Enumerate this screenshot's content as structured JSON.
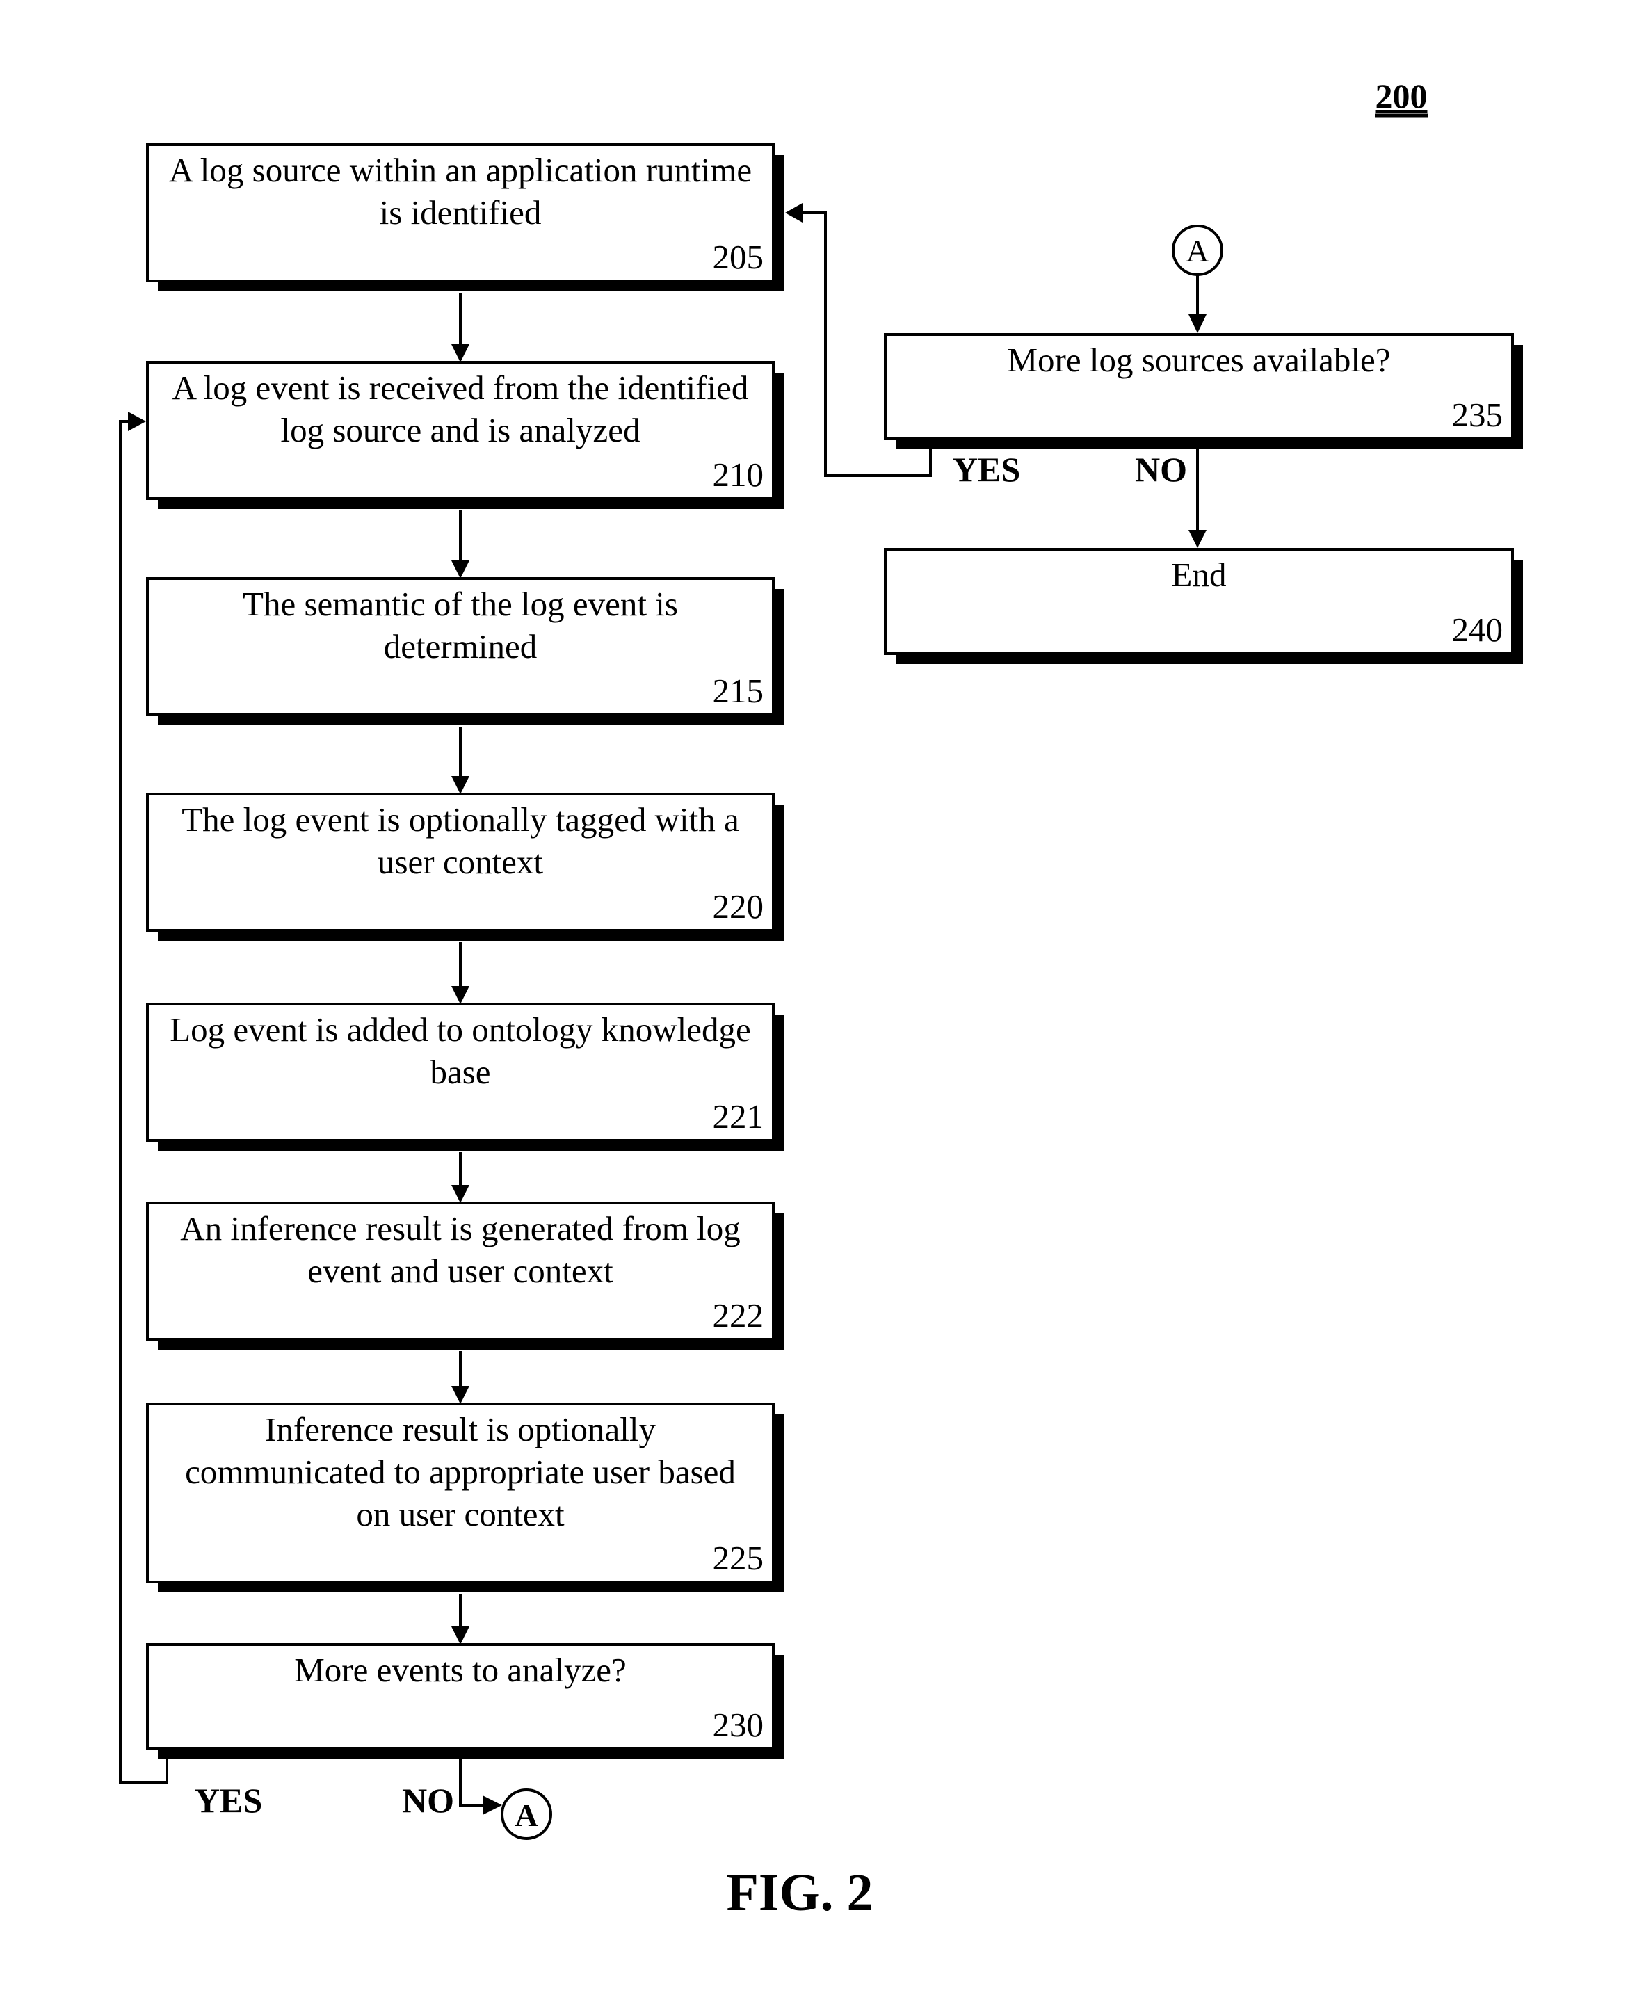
{
  "figure": {
    "reference_number": "200",
    "caption": "FIG. 2"
  },
  "steps": [
    {
      "id": "205",
      "lines": [
        "A log source within an application runtime",
        "is identified"
      ]
    },
    {
      "id": "210",
      "lines": [
        "A log event is received from the identified",
        "log source and is analyzed"
      ]
    },
    {
      "id": "215",
      "lines": [
        "The semantic of the log event is",
        "determined"
      ]
    },
    {
      "id": "220",
      "lines": [
        "The log event is optionally tagged with a",
        "user context"
      ]
    },
    {
      "id": "221",
      "lines": [
        "Log event is added to ontology knowledge",
        "base"
      ]
    },
    {
      "id": "222",
      "lines": [
        "An inference result is generated from log",
        "event and user context"
      ]
    },
    {
      "id": "225",
      "lines": [
        "Inference result is optionally",
        "communicated to appropriate user based",
        "on user context"
      ]
    },
    {
      "id": "230",
      "lines": [
        "More events to analyze?"
      ]
    },
    {
      "id": "235",
      "lines": [
        "More log sources available?"
      ]
    },
    {
      "id": "240",
      "lines": [
        "End"
      ]
    }
  ],
  "branches": {
    "decision_230": {
      "yes_label": "YES",
      "no_label": "NO"
    },
    "decision_235": {
      "yes_label": "YES",
      "no_label": "NO"
    }
  },
  "connectors": {
    "off_page_out": "A",
    "off_page_in": "A"
  },
  "edges": [
    {
      "from": "205",
      "to": "210"
    },
    {
      "from": "210",
      "to": "215"
    },
    {
      "from": "215",
      "to": "220"
    },
    {
      "from": "220",
      "to": "221"
    },
    {
      "from": "221",
      "to": "222"
    },
    {
      "from": "222",
      "to": "225"
    },
    {
      "from": "225",
      "to": "230"
    },
    {
      "from": "230",
      "to": "210",
      "label": "YES"
    },
    {
      "from": "230",
      "to": "A",
      "label": "NO"
    },
    {
      "from": "A",
      "to": "235"
    },
    {
      "from": "235",
      "to": "205",
      "label": "YES"
    },
    {
      "from": "235",
      "to": "240",
      "label": "NO"
    }
  ]
}
